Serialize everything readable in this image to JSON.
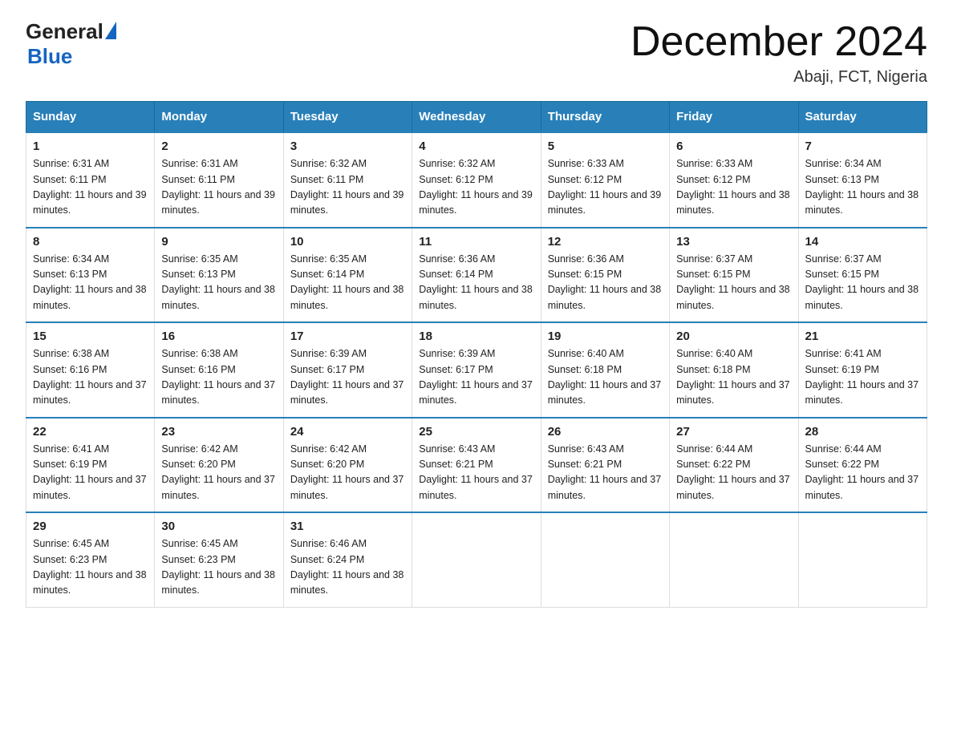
{
  "header": {
    "logo_text1": "General",
    "logo_text2": "Blue",
    "month_title": "December 2024",
    "location": "Abaji, FCT, Nigeria"
  },
  "weekdays": [
    "Sunday",
    "Monday",
    "Tuesday",
    "Wednesday",
    "Thursday",
    "Friday",
    "Saturday"
  ],
  "weeks": [
    [
      {
        "day": "1",
        "sunrise": "6:31 AM",
        "sunset": "6:11 PM",
        "daylight": "11 hours and 39 minutes."
      },
      {
        "day": "2",
        "sunrise": "6:31 AM",
        "sunset": "6:11 PM",
        "daylight": "11 hours and 39 minutes."
      },
      {
        "day": "3",
        "sunrise": "6:32 AM",
        "sunset": "6:11 PM",
        "daylight": "11 hours and 39 minutes."
      },
      {
        "day": "4",
        "sunrise": "6:32 AM",
        "sunset": "6:12 PM",
        "daylight": "11 hours and 39 minutes."
      },
      {
        "day": "5",
        "sunrise": "6:33 AM",
        "sunset": "6:12 PM",
        "daylight": "11 hours and 39 minutes."
      },
      {
        "day": "6",
        "sunrise": "6:33 AM",
        "sunset": "6:12 PM",
        "daylight": "11 hours and 38 minutes."
      },
      {
        "day": "7",
        "sunrise": "6:34 AM",
        "sunset": "6:13 PM",
        "daylight": "11 hours and 38 minutes."
      }
    ],
    [
      {
        "day": "8",
        "sunrise": "6:34 AM",
        "sunset": "6:13 PM",
        "daylight": "11 hours and 38 minutes."
      },
      {
        "day": "9",
        "sunrise": "6:35 AM",
        "sunset": "6:13 PM",
        "daylight": "11 hours and 38 minutes."
      },
      {
        "day": "10",
        "sunrise": "6:35 AM",
        "sunset": "6:14 PM",
        "daylight": "11 hours and 38 minutes."
      },
      {
        "day": "11",
        "sunrise": "6:36 AM",
        "sunset": "6:14 PM",
        "daylight": "11 hours and 38 minutes."
      },
      {
        "day": "12",
        "sunrise": "6:36 AM",
        "sunset": "6:15 PM",
        "daylight": "11 hours and 38 minutes."
      },
      {
        "day": "13",
        "sunrise": "6:37 AM",
        "sunset": "6:15 PM",
        "daylight": "11 hours and 38 minutes."
      },
      {
        "day": "14",
        "sunrise": "6:37 AM",
        "sunset": "6:15 PM",
        "daylight": "11 hours and 38 minutes."
      }
    ],
    [
      {
        "day": "15",
        "sunrise": "6:38 AM",
        "sunset": "6:16 PM",
        "daylight": "11 hours and 37 minutes."
      },
      {
        "day": "16",
        "sunrise": "6:38 AM",
        "sunset": "6:16 PM",
        "daylight": "11 hours and 37 minutes."
      },
      {
        "day": "17",
        "sunrise": "6:39 AM",
        "sunset": "6:17 PM",
        "daylight": "11 hours and 37 minutes."
      },
      {
        "day": "18",
        "sunrise": "6:39 AM",
        "sunset": "6:17 PM",
        "daylight": "11 hours and 37 minutes."
      },
      {
        "day": "19",
        "sunrise": "6:40 AM",
        "sunset": "6:18 PM",
        "daylight": "11 hours and 37 minutes."
      },
      {
        "day": "20",
        "sunrise": "6:40 AM",
        "sunset": "6:18 PM",
        "daylight": "11 hours and 37 minutes."
      },
      {
        "day": "21",
        "sunrise": "6:41 AM",
        "sunset": "6:19 PM",
        "daylight": "11 hours and 37 minutes."
      }
    ],
    [
      {
        "day": "22",
        "sunrise": "6:41 AM",
        "sunset": "6:19 PM",
        "daylight": "11 hours and 37 minutes."
      },
      {
        "day": "23",
        "sunrise": "6:42 AM",
        "sunset": "6:20 PM",
        "daylight": "11 hours and 37 minutes."
      },
      {
        "day": "24",
        "sunrise": "6:42 AM",
        "sunset": "6:20 PM",
        "daylight": "11 hours and 37 minutes."
      },
      {
        "day": "25",
        "sunrise": "6:43 AM",
        "sunset": "6:21 PM",
        "daylight": "11 hours and 37 minutes."
      },
      {
        "day": "26",
        "sunrise": "6:43 AM",
        "sunset": "6:21 PM",
        "daylight": "11 hours and 37 minutes."
      },
      {
        "day": "27",
        "sunrise": "6:44 AM",
        "sunset": "6:22 PM",
        "daylight": "11 hours and 37 minutes."
      },
      {
        "day": "28",
        "sunrise": "6:44 AM",
        "sunset": "6:22 PM",
        "daylight": "11 hours and 37 minutes."
      }
    ],
    [
      {
        "day": "29",
        "sunrise": "6:45 AM",
        "sunset": "6:23 PM",
        "daylight": "11 hours and 38 minutes."
      },
      {
        "day": "30",
        "sunrise": "6:45 AM",
        "sunset": "6:23 PM",
        "daylight": "11 hours and 38 minutes."
      },
      {
        "day": "31",
        "sunrise": "6:46 AM",
        "sunset": "6:24 PM",
        "daylight": "11 hours and 38 minutes."
      },
      null,
      null,
      null,
      null
    ]
  ]
}
